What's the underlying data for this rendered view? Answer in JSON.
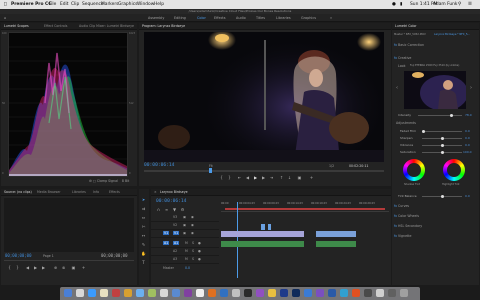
{
  "menubar": {
    "app_name": "Premiere Pro CC",
    "items": [
      "File",
      "Edit",
      "Clip",
      "Sequence",
      "Markers",
      "Graphics",
      "Window",
      "Help"
    ],
    "clock": "Sun 1:41 PM",
    "user": "Adam Funk"
  },
  "path": "/Users/adamfunk/Creative Cloud Files/Proxies Our Bones Resolutions",
  "workspaces": [
    "Assembly",
    "Editing",
    "Color",
    "Effects",
    "Audio",
    "Titles",
    "Libraries",
    "Graphics"
  ],
  "workspace_active": "Color",
  "scopes_panel": {
    "tabs": [
      "Lumetri Scopes",
      "Effect Controls",
      "Audio Clip Mixer: Lumetri Birdseye"
    ],
    "active_tab": "Lumetri Scopes",
    "scale_left": [
      "100",
      "90",
      "80",
      "70",
      "60",
      "50",
      "40",
      "30",
      "20",
      "10",
      "0"
    ],
    "scale_right": [
      "1023",
      "920",
      "818",
      "716",
      "614",
      "512",
      "409",
      "307",
      "205",
      "102",
      "0"
    ],
    "clamp_label": "Clamp Signal",
    "bit_depth": "8 Bit"
  },
  "program": {
    "title": "Program: Larynxx Birdseye",
    "timecode_in": "00:00:06:14",
    "fit": "Fit",
    "ratio": "1/2",
    "timecode_out": "00:02:20:11"
  },
  "source": {
    "tabs": [
      "Source: (no clips)",
      "Media Browser",
      "Libraries",
      "Info",
      "Effects"
    ],
    "timecode": "00;00;00;00",
    "page": "Page 1",
    "timecode_right": "00;00;00;00"
  },
  "timeline": {
    "tab": "Larynxx Birdseye",
    "timecode": "00:00:06:14",
    "ruler": [
      "00:00",
      "00:00:04:23",
      "00:00:09:23",
      "00:00:14:23",
      "00:00:19:23",
      "00:00:24:23",
      "00:00:29:23",
      "00:00:34:23"
    ],
    "tracks": [
      "V3",
      "V2",
      "V1",
      "A1",
      "A2",
      "A3",
      "Master"
    ],
    "master_value": "0.0"
  },
  "lumetri": {
    "title": "Lumetri Color",
    "master": "Master * NFX_5052.MOV",
    "target": "Larynxx Birdseye * NFX_5...",
    "sections": [
      "Basic Correction",
      "Creative"
    ],
    "look_label": "Look",
    "look_value": "Fuji ETERNA 250D Fuji 3510 (by Adobe)",
    "intensity_label": "Intensity",
    "intensity_value": "78.0",
    "adjustments_label": "Adjustments",
    "sliders": [
      {
        "label": "Faded Film",
        "value": "0.0",
        "pos": 0.0
      },
      {
        "label": "Sharpen",
        "value": "0.0",
        "pos": 0.5
      },
      {
        "label": "Vibrance",
        "value": "0.0",
        "pos": 0.5
      },
      {
        "label": "Saturation",
        "value": "100.0",
        "pos": 0.5
      }
    ],
    "wheel_left": "Shadow Tint",
    "wheel_right": "Highlight Tint",
    "tint_balance_label": "Tint Balance",
    "tint_balance_value": "0.0",
    "bottom_sections": [
      "Curves",
      "Color Wheels",
      "HSL Secondary",
      "Vignette"
    ]
  },
  "dock": {
    "colors": [
      "#4a7fd6",
      "#d8d8d8",
      "#3a9bff",
      "#e8e0c0",
      "#c04040",
      "#d7a030",
      "#6bb0f0",
      "#a0c060",
      "#d8d8d8",
      "#5a8ad0",
      "#8040a0",
      "#f0f0f0",
      "#e07020",
      "#3070c0",
      "#c0c0c0",
      "#2a2a2a",
      "#9050c0",
      "#e8c040",
      "#1e3a8a",
      "#0f2a5a",
      "#3a7bd5",
      "#7a4fbf",
      "#2a5aa8",
      "#30a0d0",
      "#e05020",
      "#4a4a4a",
      "#d0d0d0",
      "#606060",
      "#a0a0a0"
    ]
  }
}
